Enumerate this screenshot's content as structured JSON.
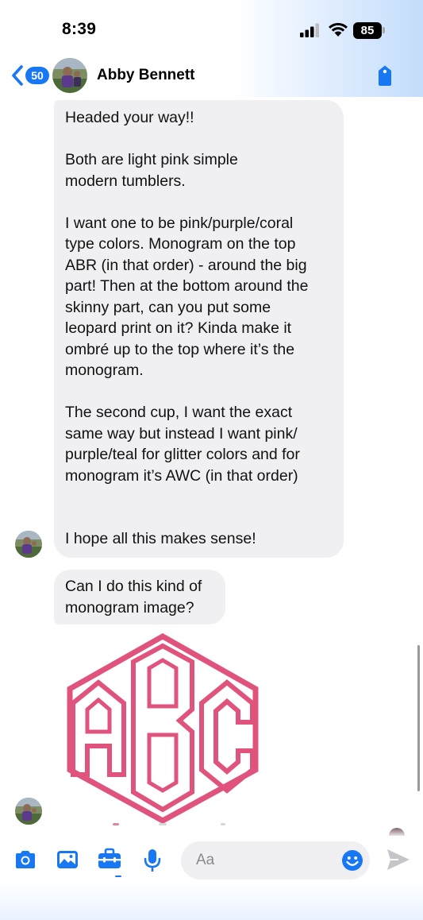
{
  "status_bar": {
    "time": "8:39",
    "battery": "85"
  },
  "header": {
    "back_count": "50",
    "contact_name": "Abby Bennett",
    "icons": [
      "chevron-left-icon",
      "tag-icon"
    ]
  },
  "messages": [
    {
      "text": "Headed your way!!\n\nBoth are light pink simple\nmodern tumblers.\n\nI want one to be pink/purple/coral\ntype colors. Monogram on the top\nABR (in that order) - around the big\npart! Then at the bottom around the\nskinny part, can you put some\nleopard print on it? Kinda make it\nombré up to the top where it’s the\nmonogram.\n\nThe second cup, I want the exact\nsame way but instead I want pink/\npurple/teal for glitter colors and for\nmonogram it’s AWC (in that order)\n\n\nI hope all this makes sense!"
    },
    {
      "text": "Can I do this kind of\nmonogram image?"
    }
  ],
  "monogram_image": {
    "letters": "ABC",
    "color": "#e0537d"
  },
  "composer": {
    "placeholder": "Aa",
    "icons": [
      "camera-icon",
      "image-icon",
      "toolbox-icon",
      "microphone-icon",
      "emoji-icon",
      "send-icon"
    ]
  },
  "colors": {
    "accent": "#1877f2",
    "bubble": "#f0f0f2"
  }
}
